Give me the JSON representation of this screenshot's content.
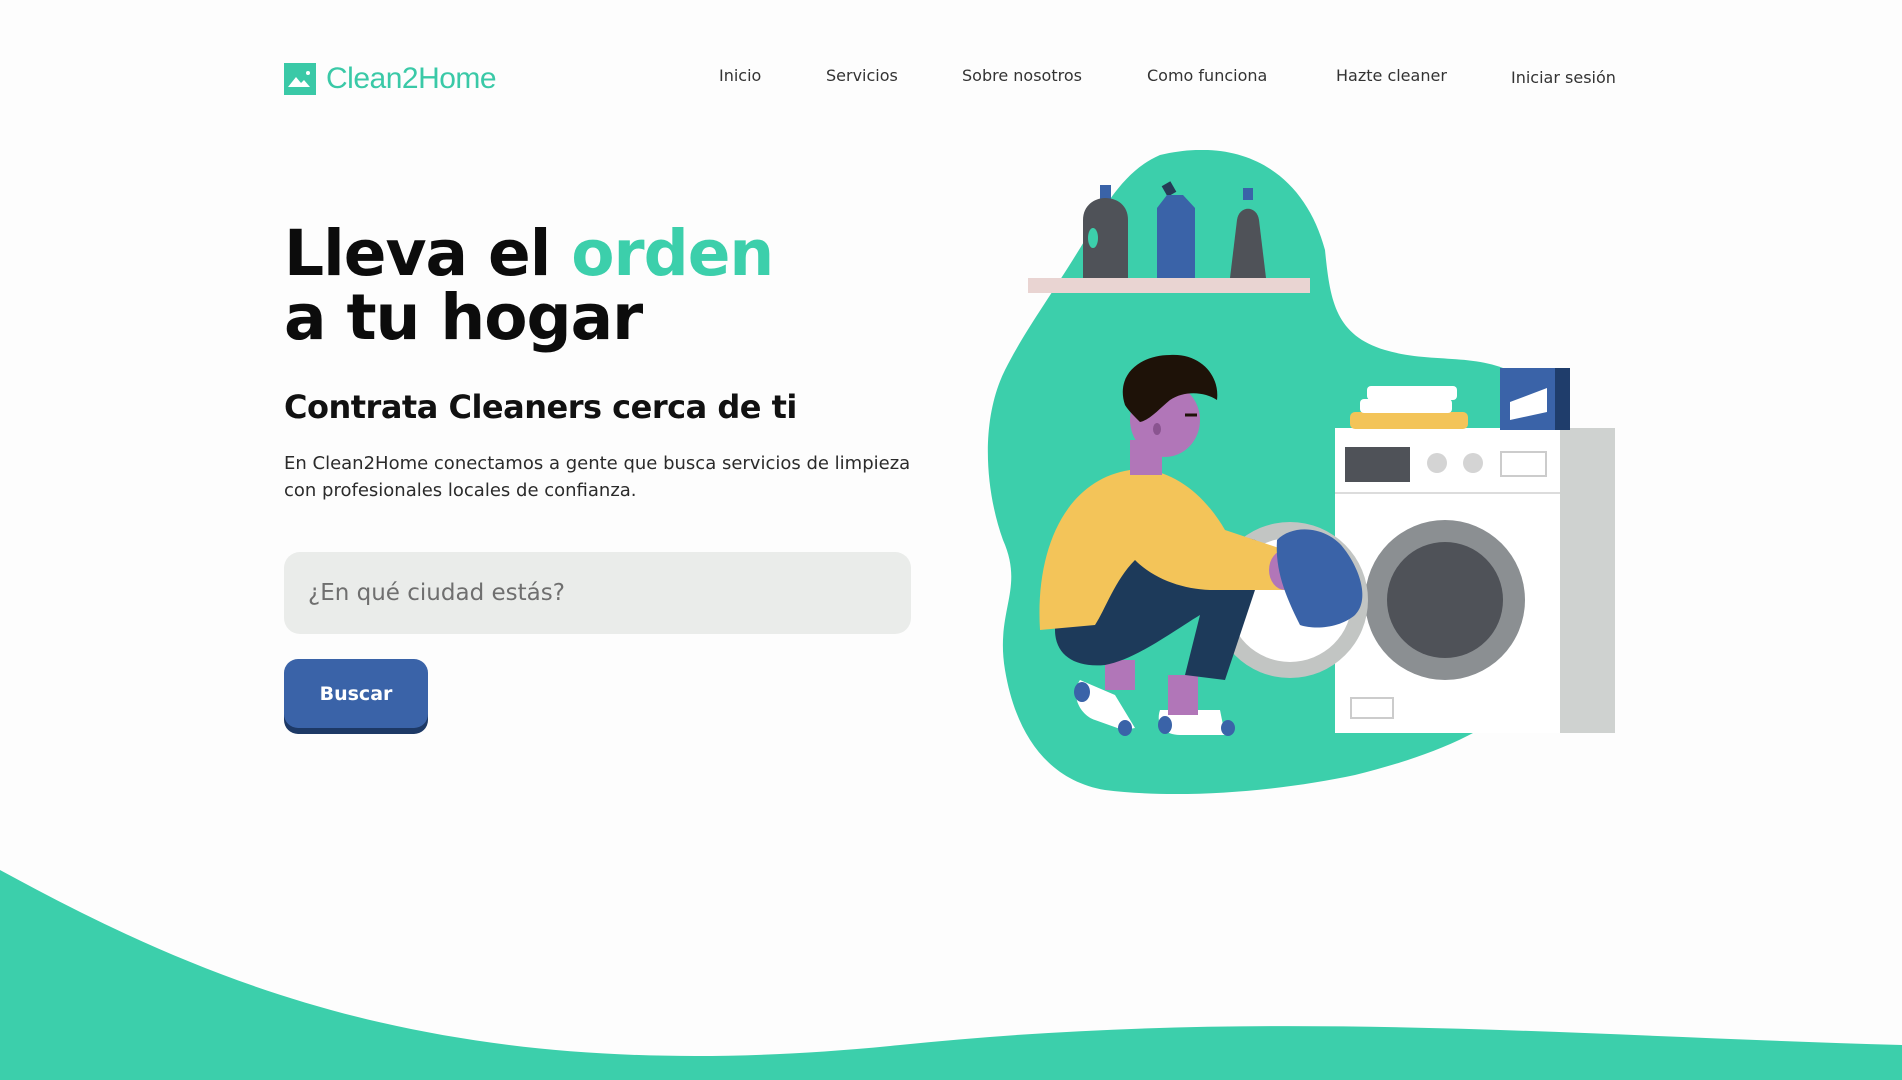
{
  "brand": {
    "name": "Clean2Home",
    "accent_color": "#3ccfab",
    "logo_icon": "mountain-logo-icon"
  },
  "nav": {
    "items": [
      {
        "label": "Inicio"
      },
      {
        "label": "Servicios"
      },
      {
        "label": "Sobre nosotros"
      },
      {
        "label": "Como funciona"
      },
      {
        "label": "Hazte cleaner"
      },
      {
        "label": "Iniciar sesión"
      }
    ]
  },
  "hero": {
    "title_part1": "Lleva el ",
    "title_accent": "orden",
    "title_part2": " a tu hogar",
    "subtitle": "Contrata Cleaners cerca de ti",
    "description": "En Clean2Home conectamos a gente que busca servicios de limpieza con profesionales locales de confianza.",
    "search": {
      "placeholder": "¿En qué ciudad estás?",
      "value": ""
    },
    "button_label": "Buscar",
    "button_color": "#3a63a8"
  },
  "illustration": {
    "icon": "person-laundry-illustration",
    "blob_color": "#3ccfab"
  }
}
